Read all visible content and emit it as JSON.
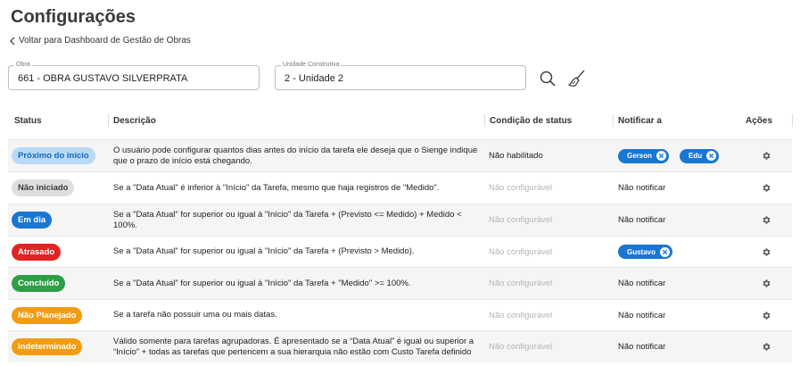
{
  "header": {
    "title": "Configurações",
    "back_label": "Voltar para Dashboard de Gestão de Obras"
  },
  "filters": {
    "obra": {
      "label": "Obra",
      "value": "661 - OBRA GUSTAVO SILVERPRATA"
    },
    "unidade": {
      "label": "Unidade Construtiva",
      "value": "2 - Unidade 2"
    },
    "search_icon": "search-icon",
    "clear_icon": "broom-icon"
  },
  "table": {
    "columns": [
      "Status",
      "Descrição",
      "Condição de status",
      "Notificar a",
      "Ações"
    ],
    "rows": [
      {
        "status": "Próximo do início",
        "status_bg": "#b9d9f5",
        "status_fg": "#1565c0",
        "desc_1": "O usuário pode configurar quantos dias antes do início da tarefa ele deseja que o Sienge indique",
        "desc_2": "que o prazo de início está chegando.",
        "condicao": "Não habilitado",
        "notificar": "",
        "chips": [
          "Gerson",
          "Edu"
        ]
      },
      {
        "status": "Não iniciado",
        "status_bg": "#dedede",
        "status_fg": "#3a3a3a",
        "desc_1": "Se a \"Data Atual\" é inferior à \"Início\" da Tarefa, mesmo que haja registros de \"Medido\".",
        "desc_2": "",
        "condicao": "Não configurável",
        "notificar": "Não notificar",
        "chips": []
      },
      {
        "status": "Em dia",
        "status_bg": "#1976d2",
        "status_fg": "#ffffff",
        "desc_1": "Se a \"Data Atual\" for superior ou igual à \"Início\" da Tarefa + (Previsto <= Medido) + Medido <",
        "desc_2": "100%.",
        "condicao": "Não configurável",
        "notificar": "Não notificar",
        "chips": []
      },
      {
        "status": "Atrasado",
        "status_bg": "#e02424",
        "status_fg": "#ffffff",
        "desc_1": "Se a \"Data Atual\" for superior ou igual à \"Início\" da Tarefa + (Previsto > Medido).",
        "desc_2": "",
        "condicao": "Não configurável",
        "notificar": "",
        "chips": [
          "Gustavo"
        ]
      },
      {
        "status": "Concluído",
        "status_bg": "#2e9e45",
        "status_fg": "#ffffff",
        "desc_1": "Se a \"Data Atual\" for superior ou igual à \"Início\" da Tarefa + \"Medido\" >= 100%.",
        "desc_2": "",
        "condicao": "Não configurável",
        "notificar": "Não notificar",
        "chips": []
      },
      {
        "status": "Não Planejado",
        "status_bg": "#f39c12",
        "status_fg": "#ffffff",
        "desc_1": "Se a tarefa não possuir uma ou mais datas.",
        "desc_2": "",
        "condicao": "Não configurável",
        "notificar": "Não notificar",
        "chips": []
      },
      {
        "status": "Indeterminado",
        "status_bg": "#f39c12",
        "status_fg": "#ffffff",
        "desc_1": "Válido somente para tarefas agrupadoras. É apresentado se a “Data Atual” é igual ou superior a",
        "desc_2": "“Início” + todas as tarefas que pertencem a sua hierarquia não estão com Custo Tarefa definido",
        "condicao": "Não configurável",
        "notificar": "Não notificar",
        "chips": []
      }
    ]
  },
  "colors": {
    "chip": "#1976d2",
    "accent": "#1976d2"
  }
}
